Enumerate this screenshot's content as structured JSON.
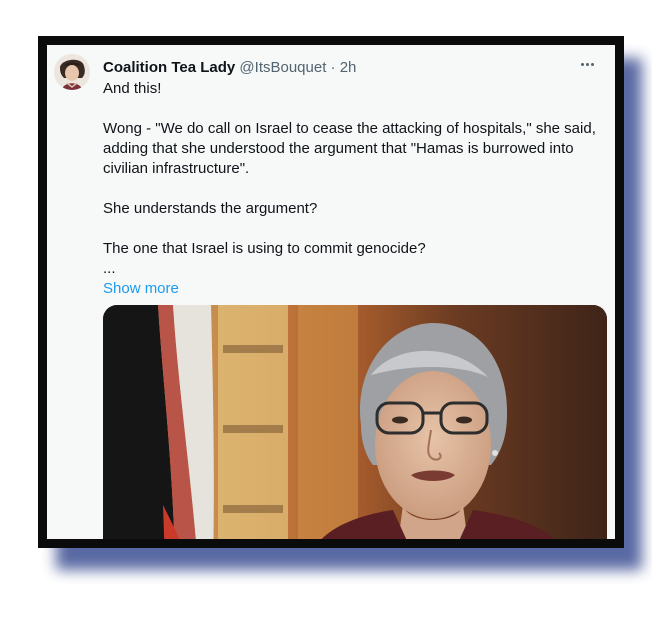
{
  "tweet": {
    "display_name": "Coalition Tea Lady",
    "handle": "@ItsBouquet",
    "separator": "·",
    "time": "2h",
    "more_icon": "more-horizontal-icon",
    "lines": [
      "And this!",
      "Wong - \"We do call on Israel to cease the attacking of hospitals,\" she said, adding that she understood the argument that \"Hamas is burrowed into civilian infrastructure\".",
      "She understands the argument?",
      "The one that Israel is using to commit genocide?",
      "..."
    ],
    "show_more": "Show more"
  },
  "colors": {
    "frame_border": "#0b0b0b",
    "shadow": "#3d4f93",
    "tweet_bg": "#f7f8f8",
    "link": "#1d9bf0",
    "secondary_text": "#536471",
    "primary_text": "#0f1419"
  }
}
